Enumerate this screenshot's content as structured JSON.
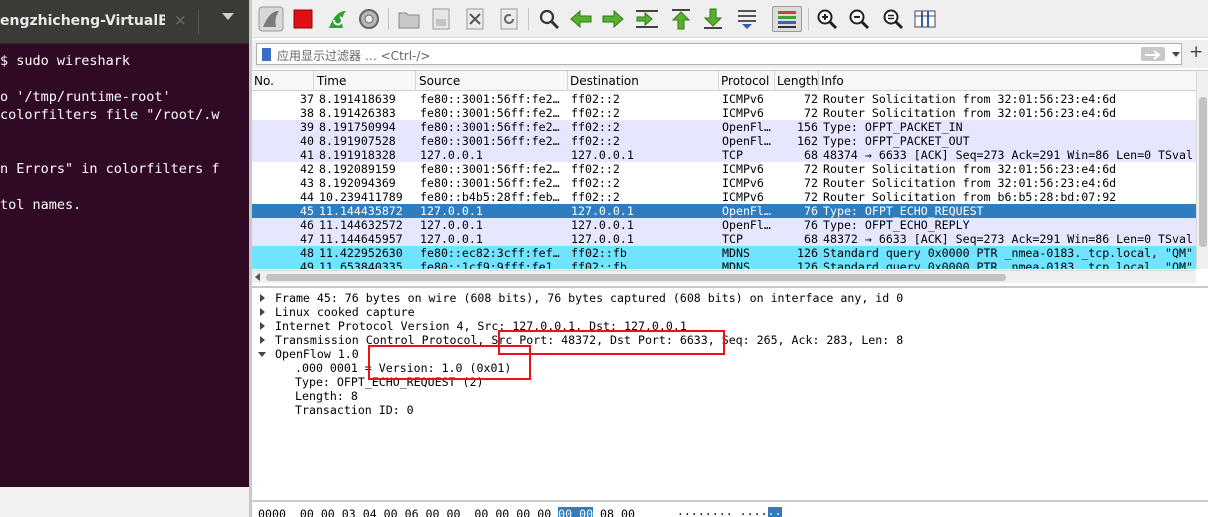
{
  "terminal": {
    "tab_title": "engzhicheng-VirtualBox: ~",
    "close_glyph": "×",
    "lines": [
      "$ sudo wireshark",
      "",
      "o '/tmp/runtime-root'",
      "colorfilters file \"/root/.w",
      "",
      "n Errors\" in colorfilters f",
      "",
      "tol names."
    ]
  },
  "filter": {
    "placeholder": "应用显示过滤器 … <Ctrl-/>",
    "add_glyph": "+"
  },
  "toolbar": {
    "icons": [
      "shark-fin-start-icon",
      "stop-capture-icon",
      "restart-capture-icon",
      "capture-options-icon",
      "open-file-icon",
      "save-file-icon",
      "close-file-icon",
      "reload-file-icon",
      "find-packet-icon",
      "go-back-icon",
      "go-forward-icon",
      "go-to-packet-icon",
      "go-first-packet-icon",
      "go-last-packet-icon",
      "auto-scroll-icon",
      "colorize-icon",
      "zoom-in-icon",
      "zoom-out-icon",
      "zoom-normal-icon",
      "resize-columns-icon"
    ]
  },
  "packet_list": {
    "columns": [
      "No.",
      "Time",
      "Source",
      "Destination",
      "Protocol",
      "Length",
      "Info"
    ],
    "rows": [
      {
        "no": "37",
        "time": "8.191418639",
        "src": "fe80::3001:56ff:fe2…",
        "dst": "ff02::2",
        "proto": "ICMPv6",
        "len": "72",
        "info": "Router Solicitation from 32:01:56:23:e4:6d",
        "style": "white"
      },
      {
        "no": "38",
        "time": "8.191426383",
        "src": "fe80::3001:56ff:fe2…",
        "dst": "ff02::2",
        "proto": "ICMPv6",
        "len": "72",
        "info": "Router Solicitation from 32:01:56:23:e4:6d",
        "style": "white"
      },
      {
        "no": "39",
        "time": "8.191750994",
        "src": "fe80::3001:56ff:fe2…",
        "dst": "ff02::2",
        "proto": "OpenFl…",
        "len": "156",
        "info": "Type: OFPT_PACKET_IN",
        "style": "lav"
      },
      {
        "no": "40",
        "time": "8.191907528",
        "src": "fe80::3001:56ff:fe2…",
        "dst": "ff02::2",
        "proto": "OpenFl…",
        "len": "162",
        "info": "Type: OFPT_PACKET_OUT",
        "style": "lav"
      },
      {
        "no": "41",
        "time": "8.191918328",
        "src": "127.0.0.1",
        "dst": "127.0.0.1",
        "proto": "TCP",
        "len": "68",
        "info": "48374 → 6633 [ACK] Seq=273 Ack=291 Win=86 Len=0 TSval",
        "style": "lav"
      },
      {
        "no": "42",
        "time": "8.192089159",
        "src": "fe80::3001:56ff:fe2…",
        "dst": "ff02::2",
        "proto": "ICMPv6",
        "len": "72",
        "info": "Router Solicitation from 32:01:56:23:e4:6d",
        "style": "white"
      },
      {
        "no": "43",
        "time": "8.192094369",
        "src": "fe80::3001:56ff:fe2…",
        "dst": "ff02::2",
        "proto": "ICMPv6",
        "len": "72",
        "info": "Router Solicitation from 32:01:56:23:e4:6d",
        "style": "white"
      },
      {
        "no": "44",
        "time": "10.239411789",
        "src": "fe80::b4b5:28ff:feb…",
        "dst": "ff02::2",
        "proto": "ICMPv6",
        "len": "72",
        "info": "Router Solicitation from b6:b5:28:bd:07:92",
        "style": "white"
      },
      {
        "no": "45",
        "time": "11.144435872",
        "src": "127.0.0.1",
        "dst": "127.0.0.1",
        "proto": "OpenFl…",
        "len": "76",
        "info": "Type: OFPT_ECHO_REQUEST",
        "style": "sel"
      },
      {
        "no": "46",
        "time": "11.144632572",
        "src": "127.0.0.1",
        "dst": "127.0.0.1",
        "proto": "OpenFl…",
        "len": "76",
        "info": "Type: OFPT_ECHO_REPLY",
        "style": "lav"
      },
      {
        "no": "47",
        "time": "11.144645957",
        "src": "127.0.0.1",
        "dst": "127.0.0.1",
        "proto": "TCP",
        "len": "68",
        "info": "48372 → 6633 [ACK] Seq=273 Ack=291 Win=86 Len=0 TSval",
        "style": "lav"
      },
      {
        "no": "48",
        "time": "11.422952630",
        "src": "fe80::ec82:3cff:fef…",
        "dst": "ff02::fb",
        "proto": "MDNS",
        "len": "126",
        "info": "Standard query 0x0000 PTR _nmea-0183._tcp.local, \"QM\"",
        "style": "mdns"
      },
      {
        "no": "49",
        "time": "11.653840335",
        "src": "fe80::1cf9:9fff:fe1…",
        "dst": "ff02::fb",
        "proto": "MDNS",
        "len": "126",
        "info": "Standard query 0x0000 PTR _nmea-0183._tcp.local, \"QM\"",
        "style": "mdns"
      }
    ]
  },
  "details": {
    "lines": [
      {
        "text": "Frame 45: 76 bytes on wire (608 bits), 76 bytes captured (608 bits) on interface any, id 0",
        "expander": "right",
        "indent": 0
      },
      {
        "text": "Linux cooked capture",
        "expander": "right",
        "indent": 0
      },
      {
        "text": "Internet Protocol Version 4, Src: 127.0.0.1, Dst: 127.0.0.1",
        "expander": "right",
        "indent": 0
      },
      {
        "text": "Transmission Control Protocol, Src Port: 48372, Dst Port: 6633, Seq: 265, Ack: 283, Len: 8",
        "expander": "right",
        "indent": 0
      },
      {
        "text": "OpenFlow 1.0",
        "expander": "down",
        "indent": 0
      },
      {
        "text": ".000 0001 = Version: 1.0 (0x01)",
        "expander": "none",
        "indent": 1
      },
      {
        "text": "Type: OFPT_ECHO_REQUEST (2)",
        "expander": "none",
        "indent": 1
      },
      {
        "text": "Length: 8",
        "expander": "none",
        "indent": 1
      },
      {
        "text": "Transaction ID: 0",
        "expander": "none",
        "indent": 1
      }
    ]
  },
  "bytes_pane": {
    "offset": "0000",
    "hex_before": "00 00 03 04 00 06 00 00  00 00 00 00",
    "hex_selected": "00 00",
    "hex_after": " 08 00",
    "ascii_before": "········ ····",
    "ascii_selected": "··"
  },
  "colors": {
    "selected_row": "#2f7dbf",
    "lavender_row": "#e7e6ff",
    "mdns_row": "#70e4ff",
    "terminal_bg": "#300a24",
    "annotation_red": "#ee1111"
  }
}
